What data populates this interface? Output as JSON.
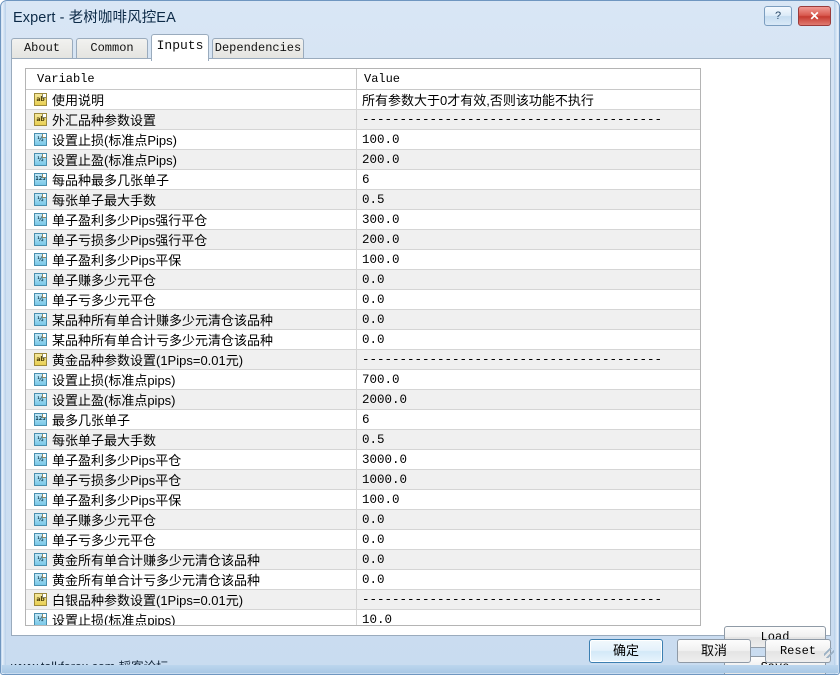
{
  "window": {
    "title": "Expert - 老树咖啡风控EA",
    "help_label": "?",
    "close_label": "✕",
    "status": "www.talkforex.com 韬客论坛"
  },
  "tabs": [
    {
      "label": "About",
      "active": false
    },
    {
      "label": "Common",
      "active": false
    },
    {
      "label": "Inputs",
      "active": true
    },
    {
      "label": "Dependencies",
      "active": false
    }
  ],
  "table": {
    "columns": [
      "Variable",
      "Value"
    ],
    "rows": [
      {
        "icon": "string-type-icon",
        "glyph": "ab",
        "variable": "使用说明",
        "value": "所有参数大于0才有效,否则该功能不执行",
        "cjk": true
      },
      {
        "icon": "string-type-icon",
        "glyph": "ab",
        "variable": "外汇品种参数设置",
        "value": "----------------------------------------"
      },
      {
        "icon": "double-type-icon",
        "glyph": "½",
        "variable": "设置止损(标准点Pips)",
        "value": "100.0"
      },
      {
        "icon": "double-type-icon",
        "glyph": "½",
        "variable": "设置止盈(标准点Pips)",
        "value": "200.0"
      },
      {
        "icon": "integer-type-icon",
        "glyph": "123",
        "variable": "每品种最多几张单子",
        "value": "6"
      },
      {
        "icon": "double-type-icon",
        "glyph": "½",
        "variable": "每张单子最大手数",
        "value": "0.5"
      },
      {
        "icon": "double-type-icon",
        "glyph": "½",
        "variable": "单子盈利多少Pips强行平仓",
        "value": "300.0"
      },
      {
        "icon": "double-type-icon",
        "glyph": "½",
        "variable": "单子亏损多少Pips强行平仓",
        "value": "200.0"
      },
      {
        "icon": "double-type-icon",
        "glyph": "½",
        "variable": "单子盈利多少Pips平保",
        "value": "100.0"
      },
      {
        "icon": "double-type-icon",
        "glyph": "½",
        "variable": "单子赚多少元平仓",
        "value": "0.0"
      },
      {
        "icon": "double-type-icon",
        "glyph": "½",
        "variable": "单子亏多少元平仓",
        "value": "0.0"
      },
      {
        "icon": "double-type-icon",
        "glyph": "½",
        "variable": "某品种所有单合计赚多少元清仓该品种",
        "value": "0.0"
      },
      {
        "icon": "double-type-icon",
        "glyph": "½",
        "variable": "某品种所有单合计亏多少元清仓该品种",
        "value": "0.0"
      },
      {
        "icon": "string-type-icon",
        "glyph": "ab",
        "variable": "黄金品种参数设置(1Pips=0.01元)",
        "value": "----------------------------------------"
      },
      {
        "icon": "double-type-icon",
        "glyph": "½",
        "variable": "设置止损(标准点pips)",
        "value": "700.0"
      },
      {
        "icon": "double-type-icon",
        "glyph": "½",
        "variable": "设置止盈(标准点pips)",
        "value": "2000.0"
      },
      {
        "icon": "integer-type-icon",
        "glyph": "123",
        "variable": "最多几张单子",
        "value": "6"
      },
      {
        "icon": "double-type-icon",
        "glyph": "½",
        "variable": "每张单子最大手数",
        "value": "0.5"
      },
      {
        "icon": "double-type-icon",
        "glyph": "½",
        "variable": "单子盈利多少Pips平仓",
        "value": "3000.0"
      },
      {
        "icon": "double-type-icon",
        "glyph": "½",
        "variable": "单子亏损多少Pips平仓",
        "value": "1000.0"
      },
      {
        "icon": "double-type-icon",
        "glyph": "½",
        "variable": "单子盈利多少Pips平保",
        "value": "100.0"
      },
      {
        "icon": "double-type-icon",
        "glyph": "½",
        "variable": "单子赚多少元平仓",
        "value": "0.0"
      },
      {
        "icon": "double-type-icon",
        "glyph": "½",
        "variable": "单子亏多少元平仓",
        "value": "0.0"
      },
      {
        "icon": "double-type-icon",
        "glyph": "½",
        "variable": "黄金所有单合计赚多少元清仓该品种",
        "value": "0.0"
      },
      {
        "icon": "double-type-icon",
        "glyph": "½",
        "variable": "黄金所有单合计亏多少元清仓该品种",
        "value": "0.0"
      },
      {
        "icon": "string-type-icon",
        "glyph": "ab",
        "variable": "白银品种参数设置(1Pips=0.01元)",
        "value": "----------------------------------------"
      },
      {
        "icon": "double-type-icon",
        "glyph": "½",
        "variable": "设置止损(标准点pips)",
        "value": "10.0"
      }
    ]
  },
  "scrollbar": {
    "up_label": "▲",
    "down_label": "▼"
  },
  "side_buttons": {
    "load_label": "Load",
    "save_label": "Save"
  },
  "dialog_buttons": {
    "ok_label": "确定",
    "cancel_label": "取消",
    "reset_label": "Reset"
  }
}
